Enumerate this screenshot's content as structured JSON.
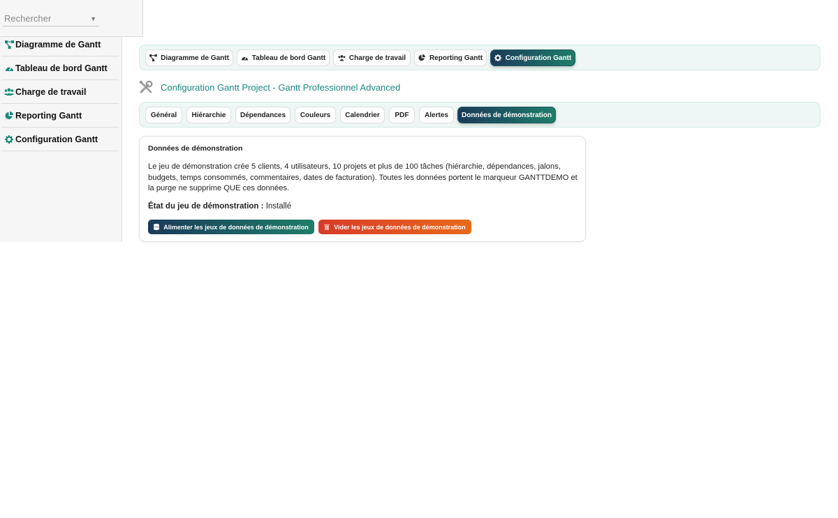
{
  "search": {
    "placeholder": "Rechercher"
  },
  "sidebar": {
    "items": [
      {
        "label": "Diagramme de Gantt",
        "icon": "diagram-icon"
      },
      {
        "label": "Tableau de bord Gantt",
        "icon": "gauge-icon"
      },
      {
        "label": "Charge de travail",
        "icon": "users-icon"
      },
      {
        "label": "Reporting Gantt",
        "icon": "pie-chart-icon"
      },
      {
        "label": "Configuration Gantt",
        "icon": "gear-icon"
      }
    ]
  },
  "top_tabs": [
    {
      "label": "Diagramme de Gantt",
      "icon": "diagram-icon",
      "active": false
    },
    {
      "label": "Tableau de bord Gantt",
      "icon": "gauge-icon",
      "active": false
    },
    {
      "label": "Charge de travail",
      "icon": "users-icon",
      "active": false
    },
    {
      "label": "Reporting Gantt",
      "icon": "pie-chart-icon",
      "active": false
    },
    {
      "label": "Configuration Gantt",
      "icon": "gear-icon",
      "active": true
    }
  ],
  "page": {
    "title": "Configuration Gantt Project - Gantt Professionnel Advanced",
    "icon": "tools-icon"
  },
  "config_tabs": [
    {
      "label": "Général",
      "active": false
    },
    {
      "label": "Hiérarchie",
      "active": false
    },
    {
      "label": "Dépendances",
      "active": false
    },
    {
      "label": "Couleurs",
      "active": false
    },
    {
      "label": "Calendrier",
      "active": false
    },
    {
      "label": "PDF",
      "active": false
    },
    {
      "label": "Alertes",
      "active": false
    },
    {
      "label": "Données de démonstration",
      "active": true
    }
  ],
  "demo": {
    "title": "Données de démonstration",
    "description": "Le jeu de démonstration crée 5 clients, 4 utilisateurs, 10 projets et plus de 100 tâches (hiérarchie, dépendances, jalons, budgets, temps consommés, commentaires, dates de facturation). Toutes les données portent le marqueur GANTTDEMO et la purge ne supprime QUE ces données.",
    "status_label": "État du jeu de démonstration :",
    "status_value": "Installé",
    "feed_button": "Alimenter les jeux de données de démonstration",
    "purge_button": "Vider les jeux de données de démonstration"
  },
  "colors": {
    "accent": "#1a8a7e",
    "active_gradient_start": "#1b3a5a",
    "active_gradient_end": "#1e7e68",
    "danger_gradient_start": "#d83a2a",
    "danger_gradient_end": "#e86a1a"
  }
}
